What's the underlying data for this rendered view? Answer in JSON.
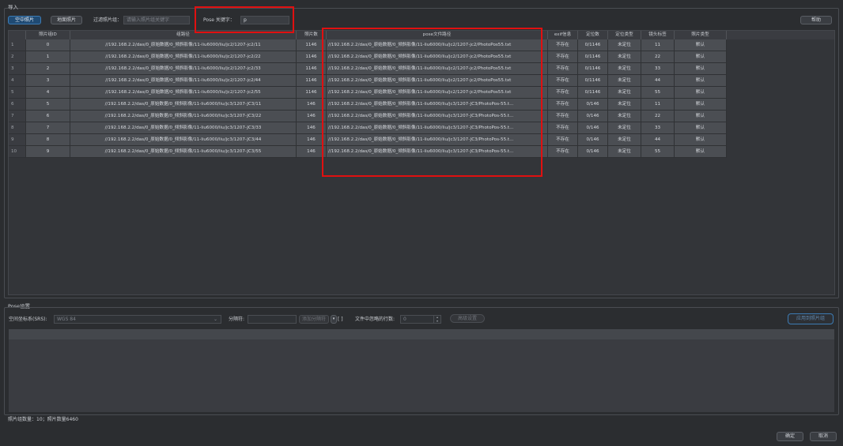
{
  "import_section": {
    "title": "导入"
  },
  "toolbar": {
    "aerial_photo": "空中照片",
    "ground_photo": "地面照片",
    "filter_label": "过滤照片组：",
    "filter_placeholder": "请输入照片组关键字",
    "pose_keyword_label": "Pose 关键字：",
    "pose_keyword_value": "p",
    "help": "帮助"
  },
  "table": {
    "columns": [
      "照片组ID",
      "组路径",
      "照片数",
      "pose文件路径",
      "exif信息",
      "定位数",
      "定位类型",
      "镜头标签",
      "照片类型"
    ],
    "rows": [
      {
        "num": "1",
        "id": "0",
        "path": "//192.168.2.2/das/0_原始数据/0_倾斜影像/11-liu6000/liu/jc2/1207-jc2/11",
        "count": "1146",
        "pose": "//192.168.2.2/das/0_原始数据/0_倾斜影像/11-liu6000/liu/jc2/1207-jc2/PhotoPos55.txt",
        "exif": "不存在",
        "loc": "0/1146",
        "loctype": "未定位",
        "lens": "11",
        "ptype": "默认"
      },
      {
        "num": "2",
        "id": "1",
        "path": "//192.168.2.2/das/0_原始数据/0_倾斜影像/11-liu6000/liu/jc2/1207-jc2/22",
        "count": "1146",
        "pose": "//192.168.2.2/das/0_原始数据/0_倾斜影像/11-liu6000/liu/jc2/1207-jc2/PhotoPos55.txt",
        "exif": "不存在",
        "loc": "0/1146",
        "loctype": "未定位",
        "lens": "22",
        "ptype": "默认"
      },
      {
        "num": "3",
        "id": "2",
        "path": "//192.168.2.2/das/0_原始数据/0_倾斜影像/11-liu6000/liu/jc2/1207-jc2/33",
        "count": "1146",
        "pose": "//192.168.2.2/das/0_原始数据/0_倾斜影像/11-liu6000/liu/jc2/1207-jc2/PhotoPos55.txt",
        "exif": "不存在",
        "loc": "0/1146",
        "loctype": "未定位",
        "lens": "33",
        "ptype": "默认"
      },
      {
        "num": "4",
        "id": "3",
        "path": "//192.168.2.2/das/0_原始数据/0_倾斜影像/11-liu6000/liu/jc2/1207-jc2/44",
        "count": "1146",
        "pose": "//192.168.2.2/das/0_原始数据/0_倾斜影像/11-liu6000/liu/jc2/1207-jc2/PhotoPos55.txt",
        "exif": "不存在",
        "loc": "0/1146",
        "loctype": "未定位",
        "lens": "44",
        "ptype": "默认"
      },
      {
        "num": "5",
        "id": "4",
        "path": "//192.168.2.2/das/0_原始数据/0_倾斜影像/11-liu6000/liu/jc2/1207-jc2/55",
        "count": "1146",
        "pose": "//192.168.2.2/das/0_原始数据/0_倾斜影像/11-liu6000/liu/jc2/1207-jc2/PhotoPos55.txt",
        "exif": "不存在",
        "loc": "0/1146",
        "loctype": "未定位",
        "lens": "55",
        "ptype": "默认"
      },
      {
        "num": "6",
        "id": "5",
        "path": "//192.168.2.2/das/0_原始数据/0_倾斜影像/11-liu6000/liu/jc3/1207-JC3/11",
        "count": "146",
        "pose": "//192.168.2.2/das/0_原始数据/0_倾斜影像/11-liu6000/liu/jc3/1207-JC3/PhotoPos-55.t...",
        "exif": "不存在",
        "loc": "0/146",
        "loctype": "未定位",
        "lens": "11",
        "ptype": "默认"
      },
      {
        "num": "7",
        "id": "6",
        "path": "//192.168.2.2/das/0_原始数据/0_倾斜影像/11-liu6000/liu/jc3/1207-JC3/22",
        "count": "146",
        "pose": "//192.168.2.2/das/0_原始数据/0_倾斜影像/11-liu6000/liu/jc3/1207-JC3/PhotoPos-55.t...",
        "exif": "不存在",
        "loc": "0/146",
        "loctype": "未定位",
        "lens": "22",
        "ptype": "默认"
      },
      {
        "num": "8",
        "id": "7",
        "path": "//192.168.2.2/das/0_原始数据/0_倾斜影像/11-liu6000/liu/jc3/1207-JC3/33",
        "count": "146",
        "pose": "//192.168.2.2/das/0_原始数据/0_倾斜影像/11-liu6000/liu/jc3/1207-JC3/PhotoPos-55.t...",
        "exif": "不存在",
        "loc": "0/146",
        "loctype": "未定位",
        "lens": "33",
        "ptype": "默认"
      },
      {
        "num": "9",
        "id": "8",
        "path": "//192.168.2.2/das/0_原始数据/0_倾斜影像/11-liu6000/liu/jc3/1207-JC3/44",
        "count": "146",
        "pose": "//192.168.2.2/das/0_原始数据/0_倾斜影像/11-liu6000/liu/jc3/1207-JC3/PhotoPos-55.t...",
        "exif": "不存在",
        "loc": "0/146",
        "loctype": "未定位",
        "lens": "44",
        "ptype": "默认"
      },
      {
        "num": "10",
        "id": "9",
        "path": "//192.168.2.2/das/0_原始数据/0_倾斜影像/11-liu6000/liu/jc3/1207-JC3/55",
        "count": "146",
        "pose": "//192.168.2.2/das/0_原始数据/0_倾斜影像/11-liu6000/liu/jc3/1207-JC3/PhotoPos-55.t...",
        "exif": "不存在",
        "loc": "0/146",
        "loctype": "未定位",
        "lens": "55",
        "ptype": "默认"
      }
    ]
  },
  "pose_settings": {
    "title": "Pose设置",
    "srs_label": "空间坐标系(SRS):",
    "srs_value": "WGS 84",
    "separator_label": "分隔符:",
    "add_separator": "添加分隔符",
    "ignore_rows_label": "文件中忽略的行数:",
    "ignore_rows_value": "0",
    "advanced": "高级设置",
    "apply": "应用到照片组"
  },
  "footer": {
    "summary": "照片组数量：10；照片数量6460",
    "ok": "确定",
    "cancel": "取消"
  },
  "colors": {
    "highlight": "#e01010",
    "accent": "#1f4a73",
    "cell": "#4b4e53"
  }
}
